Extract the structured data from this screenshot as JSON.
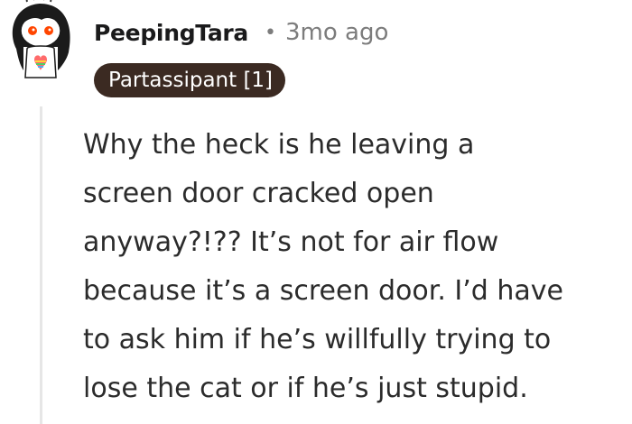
{
  "comment": {
    "author": "PeepingTara",
    "separator": "•",
    "timestamp": "3mo ago",
    "flair": "Partassipant [1]",
    "avatar_icon": "snoo-avatar-icon",
    "body_lines": [
      "Why the heck is he leaving a",
      "screen door cracked open",
      "anyway?!?? It’s not for air flow",
      "because it’s a screen door. I’d have",
      "to ask him if he’s willfully trying to",
      "lose the cat or if he’s just stupid."
    ]
  },
  "colors": {
    "flair_background": "#3b2a22",
    "username": "#1a1a1b",
    "metadata": "#7c7c7c",
    "body_text": "#2b2b2b",
    "thread_line": "#e6e6e6"
  }
}
